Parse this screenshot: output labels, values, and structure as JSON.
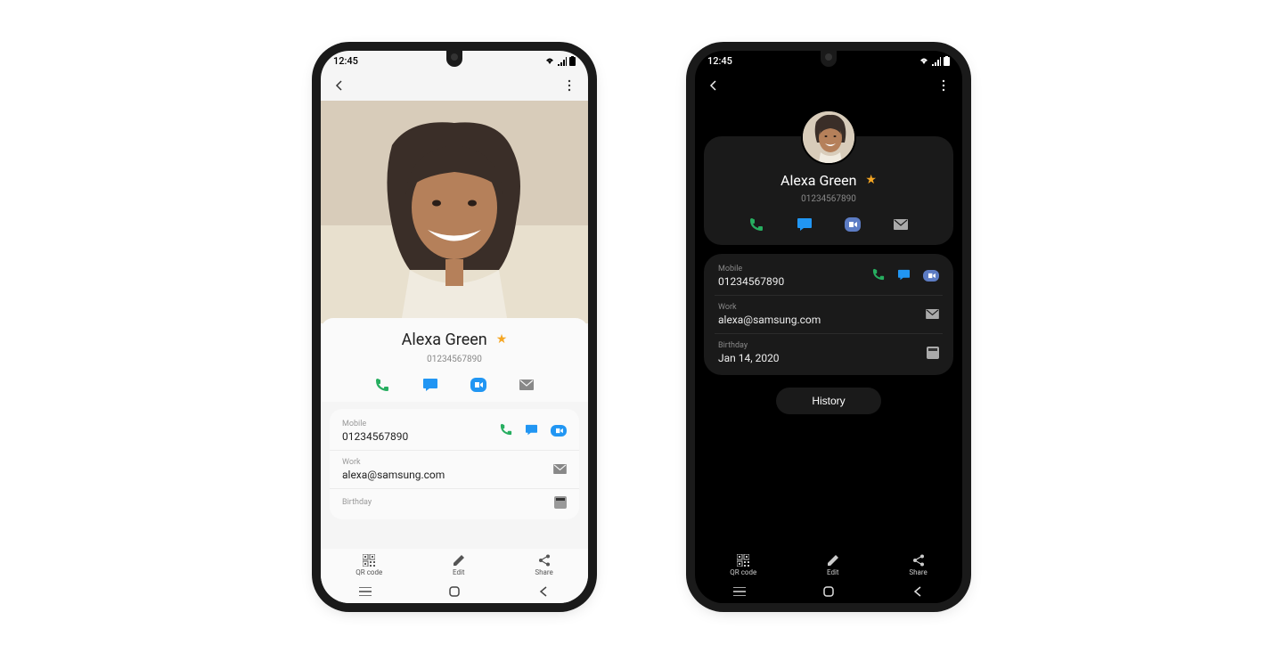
{
  "status": {
    "time": "12:45"
  },
  "contact": {
    "name": "Alexa Green",
    "phone_display": "01234567890"
  },
  "fields": {
    "mobile": {
      "label": "Mobile",
      "value": "01234567890"
    },
    "work": {
      "label": "Work",
      "value": "alexa@samsung.com"
    },
    "birthday": {
      "label": "Birthday",
      "value": "Jan 14, 2020"
    }
  },
  "buttons": {
    "history": "History",
    "qr_code": "QR code",
    "edit": "Edit",
    "share": "Share"
  }
}
